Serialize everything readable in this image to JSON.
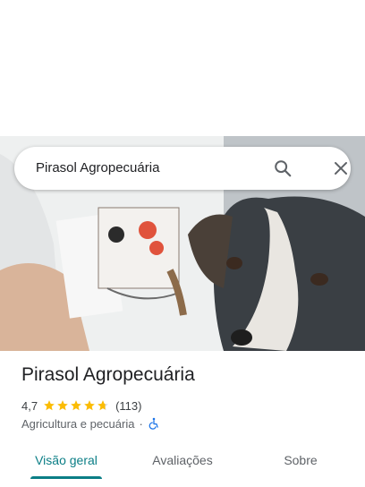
{
  "search": {
    "query": "Pirasol Agropecuária",
    "search_icon": "search-icon",
    "close_icon": "close-icon"
  },
  "place": {
    "name": "Pirasol Agropecuária",
    "rating": "4,7",
    "rating_stars": 4.7,
    "review_count": "(113)",
    "category": "Agricultura e pecuária",
    "separator": "·",
    "accessibility_icon": "wheelchair-icon"
  },
  "tabs": [
    {
      "label": "Visão geral",
      "active": true
    },
    {
      "label": "Avaliações",
      "active": false
    },
    {
      "label": "Sobre",
      "active": false
    }
  ],
  "colors": {
    "accent": "#0b7e86",
    "star": "#fbbc04",
    "accessibility": "#1a73e8"
  }
}
